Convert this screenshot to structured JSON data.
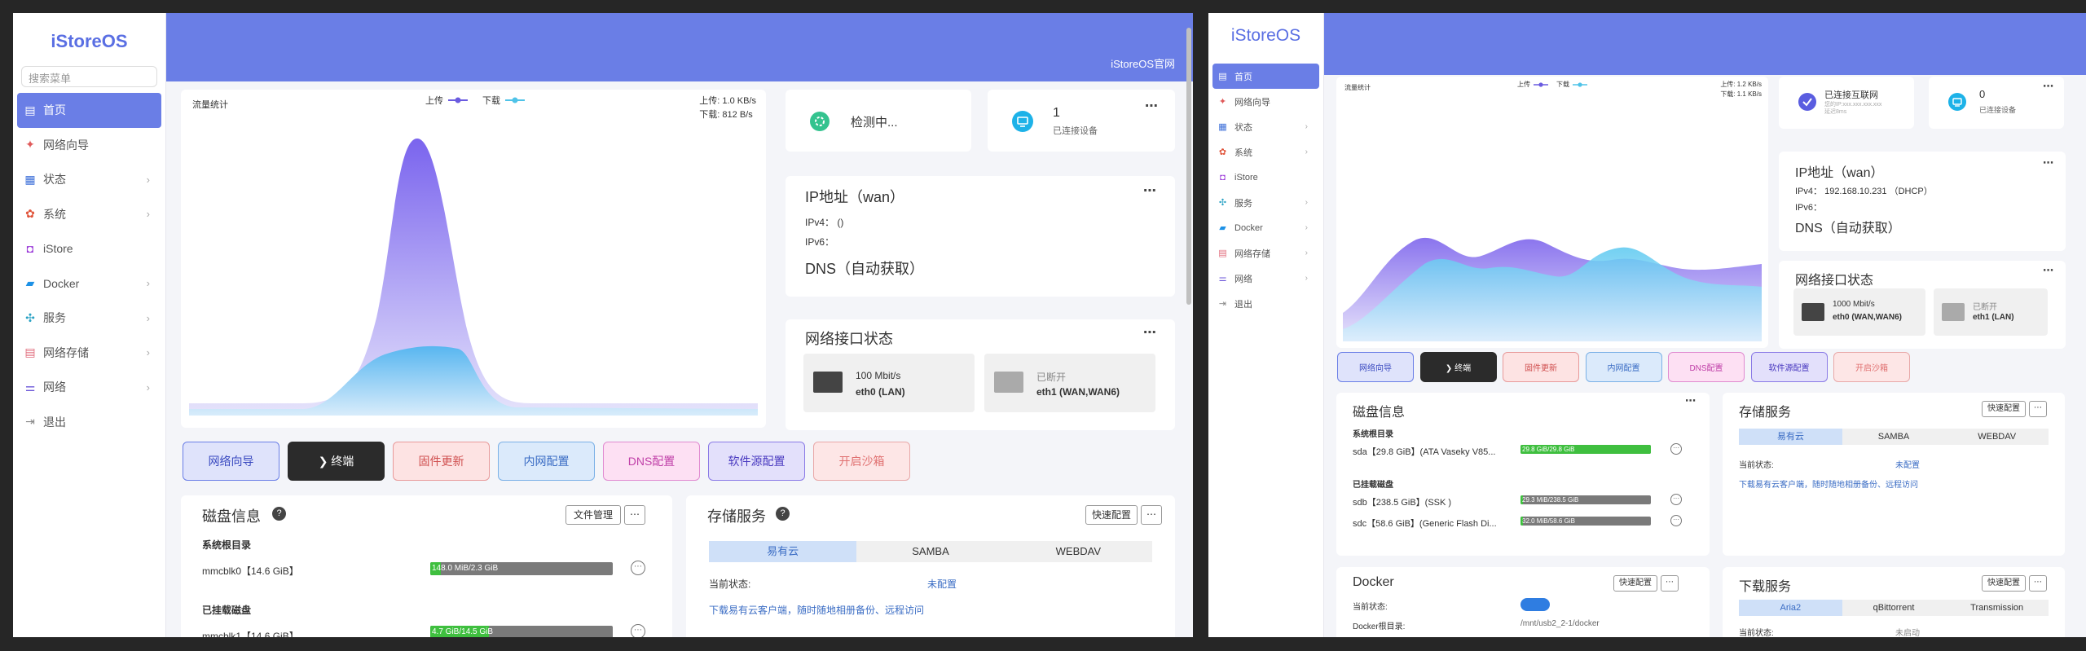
{
  "brand": "iStoreOS",
  "search_placeholder": "搜索菜单",
  "topbar_link": "iStoreOS官网",
  "colors": {
    "accent": "#6a7ee6",
    "bar_fill": "#3fbf3f",
    "upload": "#6a5be0",
    "download": "#4fc3e8"
  },
  "nav_a": [
    {
      "label": "首页",
      "icon": "home-icon",
      "active": true,
      "chev": false
    },
    {
      "label": "网络向导",
      "icon": "wizard-icon",
      "chev": false
    },
    {
      "label": "状态",
      "icon": "status-icon",
      "chev": true
    },
    {
      "label": "系统",
      "icon": "system-icon",
      "chev": true
    },
    {
      "label": "iStore",
      "icon": "store-icon",
      "chev": false
    },
    {
      "label": "Docker",
      "icon": "docker-icon",
      "chev": true
    },
    {
      "label": "服务",
      "icon": "services-icon",
      "chev": true
    },
    {
      "label": "网络存储",
      "icon": "storage-icon",
      "chev": true
    },
    {
      "label": "网络",
      "icon": "network-icon",
      "chev": true
    },
    {
      "label": "退出",
      "icon": "logout-icon",
      "chev": false
    }
  ],
  "nav_b": [
    {
      "label": "首页",
      "icon": "home-icon",
      "active": true,
      "chev": false
    },
    {
      "label": "网络向导",
      "icon": "wizard-icon",
      "chev": false
    },
    {
      "label": "状态",
      "icon": "status-icon",
      "chev": true
    },
    {
      "label": "系统",
      "icon": "system-icon",
      "chev": true
    },
    {
      "label": "iStore",
      "icon": "store-icon",
      "chev": false
    },
    {
      "label": "服务",
      "icon": "services-icon",
      "chev": true
    },
    {
      "label": "Docker",
      "icon": "docker-icon",
      "chev": true
    },
    {
      "label": "网络存储",
      "icon": "storage-icon",
      "chev": true
    },
    {
      "label": "网络",
      "icon": "network-icon",
      "chev": true
    },
    {
      "label": "退出",
      "icon": "logout-icon",
      "chev": false
    }
  ],
  "traffic": {
    "title": "流量统计",
    "legend_up": "上传",
    "legend_down": "下载"
  },
  "traffic_a": {
    "up": "上传: 1.0 KB/s",
    "down": "下载: 812 B/s"
  },
  "traffic_b": {
    "up": "上传: 1.2 KB/s",
    "down": "下载: 1.1 KB/s"
  },
  "status_a": {
    "conn": "检测中...",
    "devices_count": "1",
    "devices_label": "已连接设备"
  },
  "status_b": {
    "conn": "已连接互联网",
    "conn_sub": "您的IP:xxx.xxx.xxx.xxx 延迟8ms",
    "devices_count": "0",
    "devices_label": "已连接设备"
  },
  "ip_a": {
    "title": "IP地址（wan）",
    "ipv4_label": "IPv4：",
    "ipv4": "()",
    "ipv6_label": "IPv6：",
    "dns": "DNS（自动获取）"
  },
  "ip_b": {
    "title": "IP地址（wan）",
    "ipv4_label": "IPv4：",
    "ipv4": "192.168.10.231 （DHCP）",
    "ipv6_label": "IPv6：",
    "dns": "DNS（自动获取）"
  },
  "netif": {
    "title": "网络接口状态",
    "a": [
      {
        "speed": "100 Mbit/s",
        "name": "eth0 (LAN)"
      },
      {
        "speed": "已断开",
        "name": "eth1 (WAN,WAN6)"
      }
    ],
    "b": [
      {
        "speed": "1000 Mbit/s",
        "name": "eth0 (WAN,WAN6)"
      },
      {
        "speed": "已断开",
        "name": "eth1 (LAN)"
      }
    ]
  },
  "quick": [
    "网络向导",
    "❯ 终端",
    "固件更新",
    "内网配置",
    "DNS配置",
    "软件源配置",
    "开启沙箱"
  ],
  "disk_a": {
    "title": "磁盘信息",
    "btn": "文件管理",
    "root_label": "系统根目录",
    "mounted_label": "已挂载磁盘",
    "root": [
      {
        "name": "mmcblk0【14.6 GiB】",
        "usage": "148.0 MiB/2.3 GiB",
        "frac": 0.06
      }
    ],
    "mounted": [
      {
        "name": "mmcblk1【14.6 GiB】",
        "usage": "4.7 GiB/14.5 GiB",
        "frac": 0.32
      }
    ]
  },
  "disk_b": {
    "title": "磁盘信息",
    "root_label": "系统根目录",
    "mounted_label": "已挂载磁盘",
    "root": [
      {
        "name": "sda【29.8 GiB】(ATA Vaseky V85...",
        "usage": "29.8 GiB/29.8 GiB",
        "frac": 1.0
      }
    ],
    "mounted": [
      {
        "name": "sdb【238.5 GiB】(SSK )",
        "usage": "29.3 MiB/238.5 GiB",
        "frac": 0.01
      },
      {
        "name": "sdc【58.6 GiB】(Generic Flash Di...",
        "usage": "32.0 MiB/58.6 GiB",
        "frac": 0.01
      }
    ]
  },
  "storage": {
    "title": "存储服务",
    "btn": "快速配置",
    "tabs": [
      "易有云",
      "SAMBA",
      "WEBDAV"
    ],
    "status_label": "当前状态:",
    "status": "未配置",
    "link": "下载易有云客户端，随时随地相册备份、远程访问"
  },
  "docker": {
    "title": "Docker",
    "btn": "快速配置",
    "status_label": "当前状态:",
    "root_label": "Docker根目录:",
    "root": "/mnt/usb2_2-1/docker"
  },
  "download": {
    "title": "下载服务",
    "btn": "快速配置",
    "tabs": [
      "Aria2",
      "qBittorrent",
      "Transmission"
    ],
    "status_label": "当前状态:",
    "status": "未启动"
  }
}
